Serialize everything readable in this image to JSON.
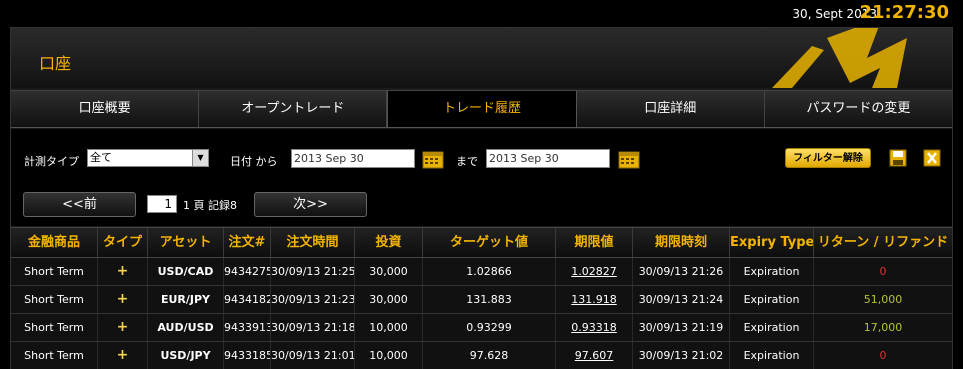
{
  "topbar": {
    "date": "30, Sept 2013",
    "time": "21:27:30"
  },
  "account": {
    "title": "口座"
  },
  "tabs": [
    {
      "label": "口座概要",
      "active": false
    },
    {
      "label": "オープントレード",
      "active": false
    },
    {
      "label": "トレード履歴",
      "active": true
    },
    {
      "label": "口座詳細",
      "active": false
    },
    {
      "label": "パスワードの変更",
      "active": false
    }
  ],
  "filter": {
    "type_label": "計測タイプ",
    "type_value": "全て",
    "date_label": "日付 から",
    "from_date": "2013 Sep 30",
    "to_label": "まで",
    "to_date": "2013 Sep 30",
    "filter_button": "フィルター解除",
    "save_icon": "save-icon",
    "excel_icon": "excel-icon"
  },
  "pager": {
    "prev_label": "<<前",
    "page_value": "1",
    "info": "1 頁 記録8",
    "next_label": "次>>"
  },
  "table": {
    "headers": [
      "金融商品",
      "タイプ",
      "アセット",
      "注文#",
      "注文時間",
      "投資",
      "ターゲット値",
      "期限値",
      "期限時刻",
      "Expiry Type",
      "リターン / リファンド"
    ],
    "rows": [
      {
        "product": "Short Term",
        "type": "+",
        "asset": "USD/CAD",
        "order": "9434275",
        "time": "30/09/13 21:25",
        "invest": "30,000",
        "target": "1.02866",
        "expiry_value": "1.02827",
        "expiry_time": "30/09/13 21:26",
        "expiry_type": "Expiration",
        "return": "0",
        "return_color": "red"
      },
      {
        "product": "Short Term",
        "type": "+",
        "asset": "EUR/JPY",
        "order": "9434182",
        "time": "30/09/13 21:23",
        "invest": "30,000",
        "target": "131.883",
        "expiry_value": "131.918",
        "expiry_time": "30/09/13 21:24",
        "expiry_type": "Expiration",
        "return": "51,000",
        "return_color": "green"
      },
      {
        "product": "Short Term",
        "type": "+",
        "asset": "AUD/USD",
        "order": "9433913",
        "time": "30/09/13 21:18",
        "invest": "10,000",
        "target": "0.93299",
        "expiry_value": "0.93318",
        "expiry_time": "30/09/13 21:19",
        "expiry_type": "Expiration",
        "return": "17,000",
        "return_color": "green"
      },
      {
        "product": "Short Term",
        "type": "+",
        "asset": "USD/JPY",
        "order": "9433185",
        "time": "30/09/13 21:01",
        "invest": "10,000",
        "target": "97.628",
        "expiry_value": "97.607",
        "expiry_time": "30/09/13 21:02",
        "expiry_type": "Expiration",
        "return": "0",
        "return_color": "red"
      }
    ]
  }
}
